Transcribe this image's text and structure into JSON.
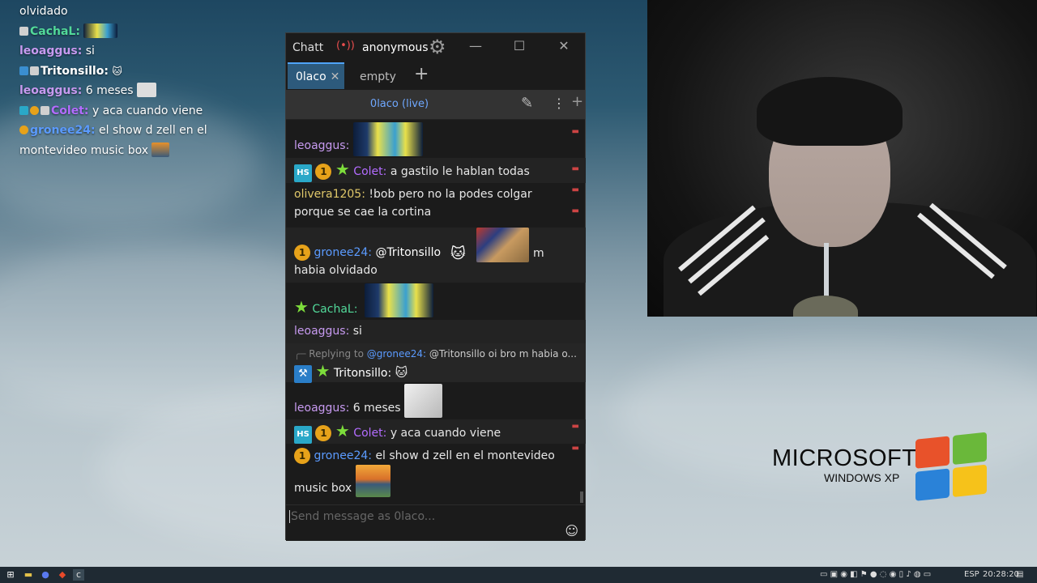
{
  "overlay_chat": [
    {
      "pre": "",
      "user": "",
      "text": "olvidado",
      "color": "#ffffff"
    },
    {
      "pre": "badge",
      "user": "CachaL:",
      "text": "",
      "color": "#52d99a",
      "emote": "pepe"
    },
    {
      "pre": "",
      "user": "leoaggus:",
      "text": "si",
      "color": "#c79af0"
    },
    {
      "pre": "badges",
      "user": "Tritonsillo:",
      "text": "",
      "color": "#ffffff",
      "emote": "cat"
    },
    {
      "pre": "",
      "user": "leoaggus:",
      "text": "6 meses",
      "color": "#c79af0",
      "emote": "meme"
    },
    {
      "pre": "badges",
      "user": "Colet:",
      "text": "y aca cuando viene",
      "color": "#b36cff"
    },
    {
      "pre": "badge",
      "user": "gronee24:",
      "text": "el show d zell en el",
      "color": "#5b9bff"
    },
    {
      "pre": "",
      "user": "",
      "text": "montevideo music box",
      "color": "#ffffff",
      "emote": "sunset"
    }
  ],
  "window": {
    "app_title": "Chatterino",
    "live_icon": "(•))",
    "account": "anonymous",
    "gear_icon": "⚙",
    "min_icon": "—",
    "max_icon": "☐",
    "close_icon": "✕",
    "tabs": [
      {
        "label": "0laco",
        "close": "✕"
      },
      {
        "label": "empty"
      }
    ],
    "tab_add": "+",
    "channel_label": "0laco (live)",
    "pen_icon": "✎",
    "dots_icon": "⋮",
    "split_add": "+",
    "input_placeholder": "Send message as 0laco...",
    "smile_icon": "☺"
  },
  "messages": [
    {
      "user": "leoaggus:",
      "text": "",
      "user_color": "#c79af0"
    },
    {
      "badges": [
        "HS",
        "1",
        "★"
      ],
      "user": "Colet:",
      "text": "a gastilo le hablan todas",
      "user_color": "#b36cff"
    },
    {
      "user": "olivera1205:",
      "text": "!bob pero no la podes colgar",
      "text2": "porque se cae la cortina",
      "user_color": "#e0c86a"
    },
    {
      "badges": [
        "1"
      ],
      "user": "gronee24:",
      "text": "@Tritonsillo",
      "text_mid": "m",
      "text2": "habia olvidado",
      "user_color": "#5b9bff"
    },
    {
      "badges": [
        "★"
      ],
      "user": "CachaL:",
      "text": "",
      "user_color": "#52d99a"
    },
    {
      "user": "leoaggus:",
      "text": "si",
      "user_color": "#c79af0"
    },
    {
      "reply_prefix": "Replying to",
      "reply_user": "@gronee24:",
      "reply_text": "@Tritonsillo oi bro m habia o...",
      "badges": [
        "⚒",
        "★"
      ],
      "user": "Tritonsillo:",
      "user_color": "#ffffff"
    },
    {
      "user": "leoaggus:",
      "text": "6 meses",
      "user_color": "#c79af0"
    },
    {
      "badges": [
        "HS",
        "1",
        "★"
      ],
      "user": "Colet:",
      "text": "y aca cuando viene",
      "user_color": "#b36cff"
    },
    {
      "badges": [
        "1"
      ],
      "user": "gronee24:",
      "text": "el show d zell en el montevideo",
      "text2": "music box",
      "user_color": "#5b9bff"
    }
  ],
  "desktop": {
    "brand": "MICROSOFT",
    "product": "WINDOWS XP"
  },
  "taskbar": {
    "language": "ESP",
    "clock": "20:28:20"
  }
}
